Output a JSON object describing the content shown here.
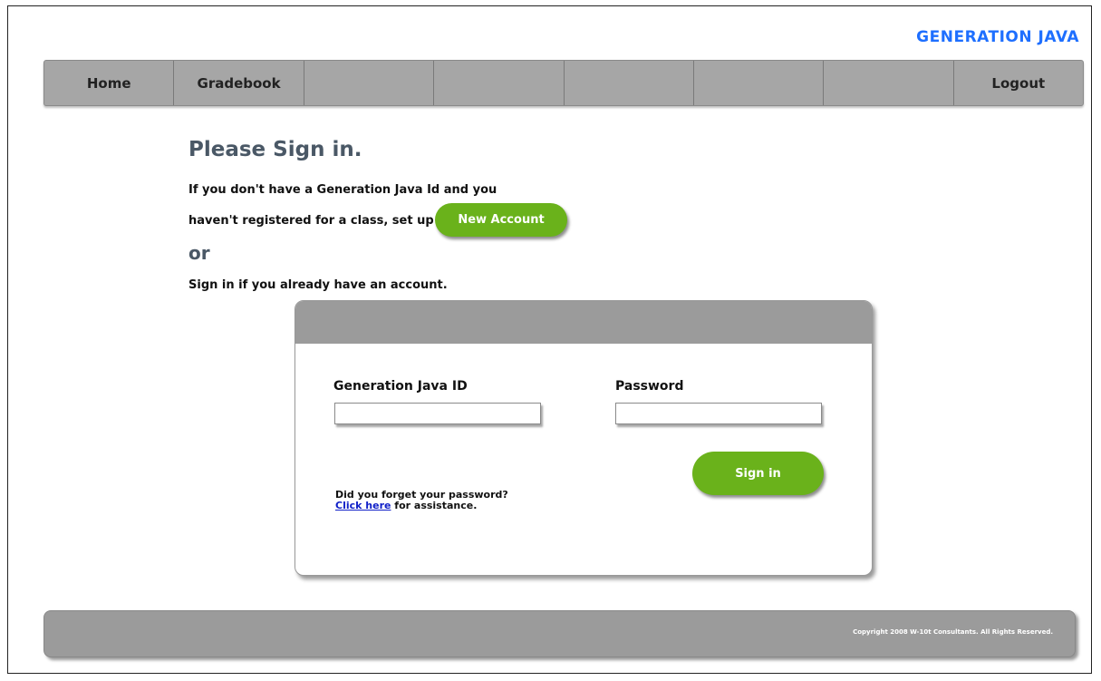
{
  "brand": "GENERATION JAVA",
  "nav": {
    "items": [
      "Home",
      "Gradebook",
      "",
      "",
      "",
      "",
      "",
      "Logout"
    ]
  },
  "main": {
    "heading": "Please Sign in.",
    "intro_line1": "If you don't have a Generation Java Id and  you",
    "intro_line2": "haven't registered for a class, set up a",
    "new_account_label": "New Account",
    "or_text": "or",
    "signin_hint": "Sign in if you already have an account."
  },
  "login": {
    "id_label": "Generation Java ID",
    "password_label": "Password",
    "id_value": "",
    "password_value": "",
    "signin_label": "Sign in",
    "forgot_question": "Did you forget your password?",
    "forgot_link": "Click here",
    "forgot_suffix": " for assistance."
  },
  "footer": {
    "copyright": "Copyright 2008  W-10t Consultants. All Rights Reserved."
  },
  "colors": {
    "brand": "#1e6fff",
    "nav_bg": "#a6a6a6",
    "accent_green": "#6ab21b",
    "heading": "#4a5866",
    "link": "#1020c8"
  }
}
